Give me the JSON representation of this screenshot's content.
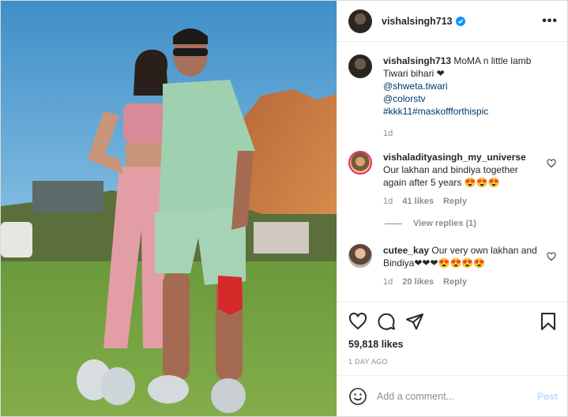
{
  "post": {
    "username": "vishalsingh713",
    "more_label": "•••"
  },
  "caption": {
    "username": "vishalsingh713",
    "text": "MoMA n little lamb Tiwari bihari ❤",
    "mention1": "@shweta.tiwari",
    "mention2": "@colorstv",
    "hashtags": "#kkk11#maskoffforthispic",
    "time": "1d"
  },
  "comments": [
    {
      "username": "vishaladityasingh_my_universe",
      "text": "Our lakhan and bindiya together again after 5 years 😍😍😍",
      "time": "1d",
      "likes": "41 likes",
      "reply": "Reply",
      "view_replies": "View replies (1)"
    },
    {
      "username": "cutee_kay",
      "text": "Our very own lakhan and Bindiya❤❤❤😍😍😍😍",
      "time": "1d",
      "likes": "20 likes",
      "reply": "Reply"
    }
  ],
  "stats": {
    "likes": "59,818 likes",
    "posted": "1 DAY AGO"
  },
  "add_comment": {
    "placeholder": "Add a comment...",
    "post_label": "Post"
  },
  "colors": {
    "link": "#00376b",
    "verified": "#0095f6",
    "post_button": "#b3dbff"
  }
}
